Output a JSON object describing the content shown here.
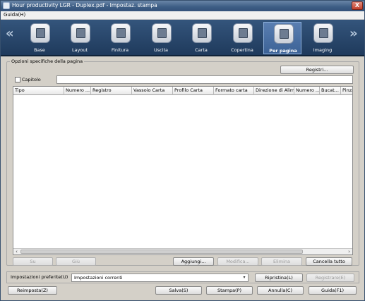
{
  "window": {
    "title": "Hour productivity LGR - Duplex.pdf - Impostaz. stampa",
    "close_glyph": "X"
  },
  "menu": {
    "help": "Guida(H)"
  },
  "ribbon": {
    "left_arrow": "«",
    "right_arrow": "»",
    "tabs": [
      {
        "label": "Base",
        "icon": "base-icon"
      },
      {
        "label": "Layout",
        "icon": "layout-icon"
      },
      {
        "label": "Finitura",
        "icon": "finishing-icon"
      },
      {
        "label": "Uscita",
        "icon": "output-icon"
      },
      {
        "label": "Carta",
        "icon": "paper-icon"
      },
      {
        "label": "Copertina",
        "icon": "cover-icon"
      },
      {
        "label": "Per pagina",
        "icon": "per-page-icon",
        "selected": true
      },
      {
        "label": "Imaging",
        "icon": "imaging-icon"
      }
    ]
  },
  "group": {
    "title": "Opzioni specifiche della pagina",
    "registri_button": "Registri...",
    "capitolo_label": "Capitolo",
    "columns": [
      "Tipo",
      "Numero ...",
      "Registro",
      "Vassoio Carta",
      "Profilo Carta",
      "Formato carta",
      "Direzione di Alim...",
      "Numero ...",
      "Bucat...",
      "Pinzat"
    ],
    "buttons": {
      "up": "Su",
      "down": "Giù",
      "add": "Aggiungi...",
      "edit": "Modifica...",
      "delete": "Elimina",
      "clear_all": "Cancella tutto"
    }
  },
  "preferences": {
    "label": "Impostazioni preferite(U)",
    "selected": "Impostazioni correnti",
    "restore": "Ripristina(L)",
    "register": "Registrare(E)"
  },
  "footer": {
    "reset": "Reimposta(Z)",
    "save": "Salva(S)",
    "print": "Stampa(P)",
    "cancel": "Annulla(C)",
    "help": "Guida(F1)"
  }
}
